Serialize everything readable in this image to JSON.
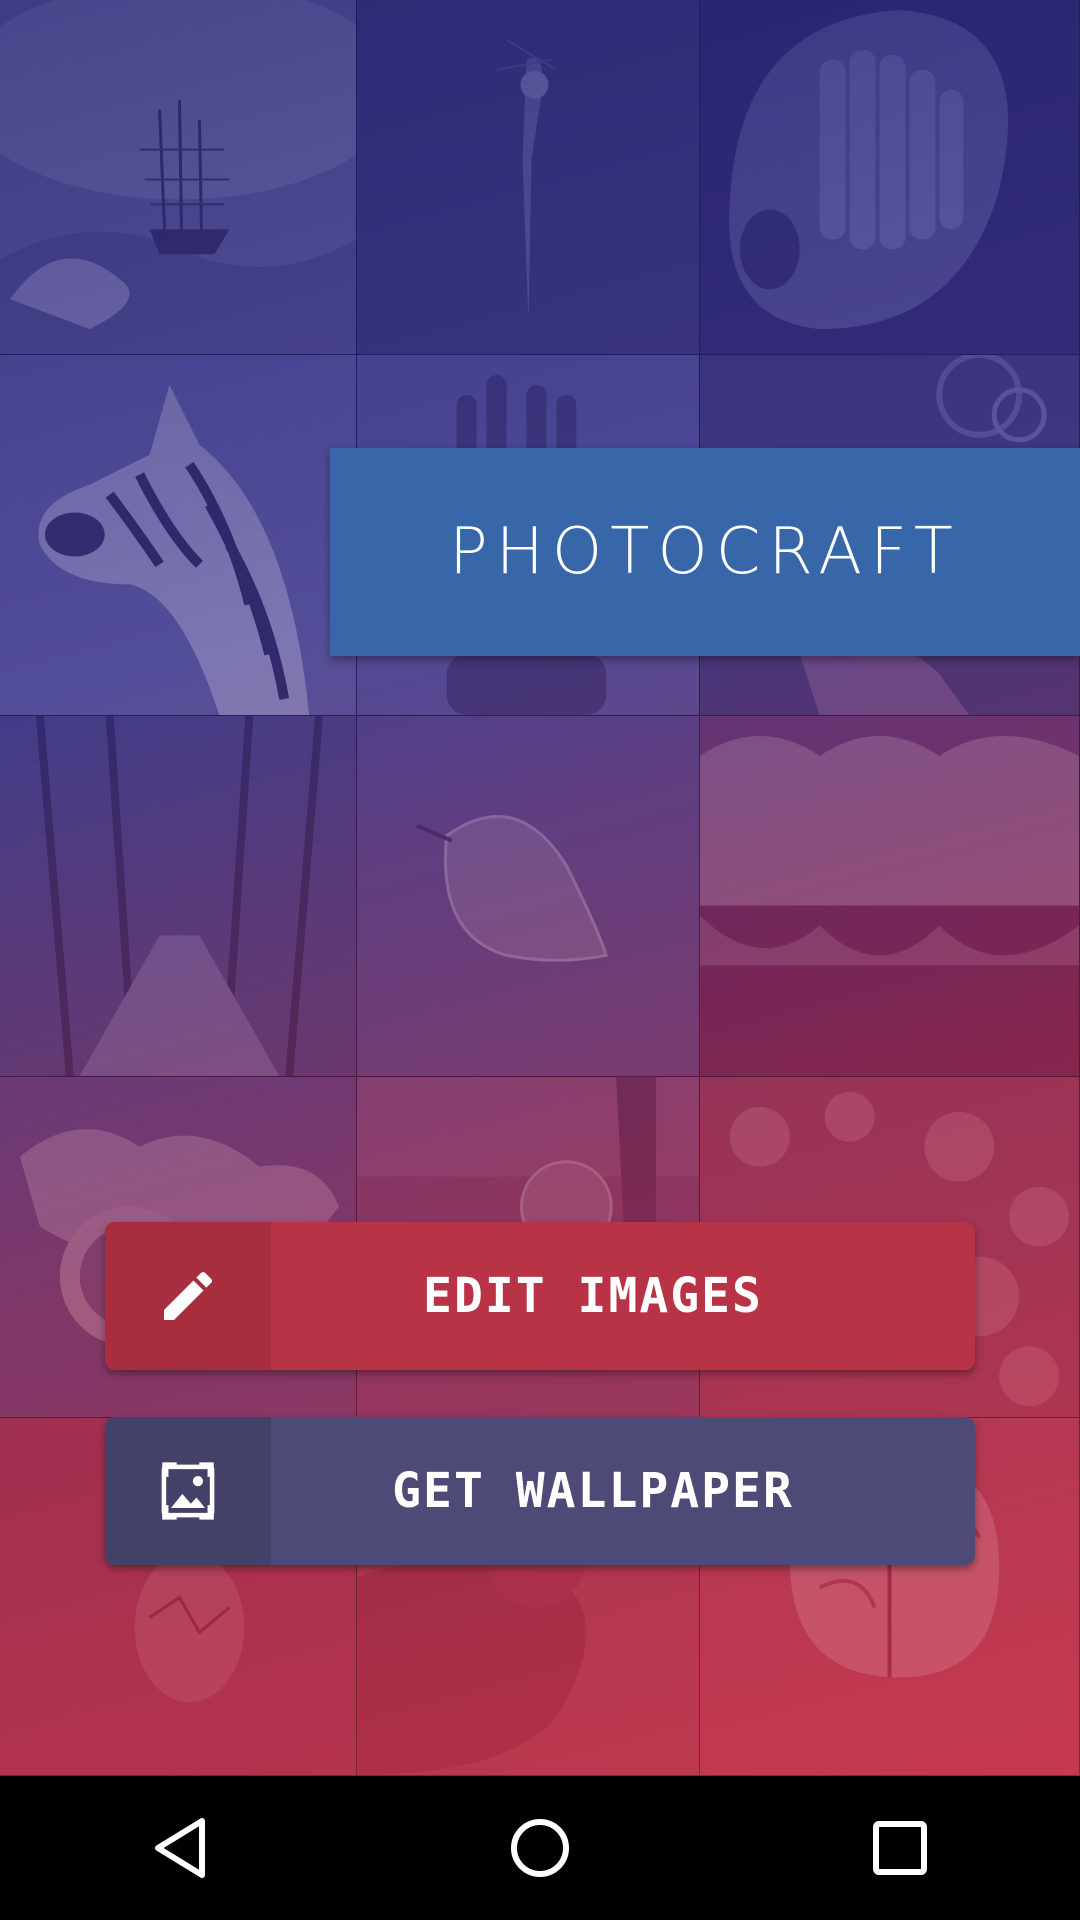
{
  "app": {
    "title": "PHOTOCRAFT"
  },
  "buttons": {
    "edit_label": "EDIT IMAGES",
    "edit_icon": "pencil-icon",
    "wallpaper_label": "GET WALLPAPER",
    "wallpaper_icon": "wallpaper-image-icon"
  },
  "navbar": {
    "back_icon": "back-triangle-icon",
    "home_icon": "home-circle-icon",
    "recents_icon": "recents-square-icon"
  },
  "colors": {
    "title_banner": "#3767a8",
    "edit_button": "#b83345",
    "wallpaper_button": "#4d4a78",
    "overlay_top": "#2a2478",
    "overlay_bottom": "#c83246"
  },
  "background_tiles": [
    "ship-in-storm",
    "parrot-on-dark-wall",
    "hand-with-crayons",
    "zebra-hand-art",
    "hands-raised",
    "bicycle-gears",
    "forest-road",
    "frosted-leaf",
    "lake-forest-reflection",
    "world-map-coffee",
    "glass-globe",
    "flower-bush",
    "cracked-egg",
    "tattooed-fist",
    "brain-illustration"
  ]
}
